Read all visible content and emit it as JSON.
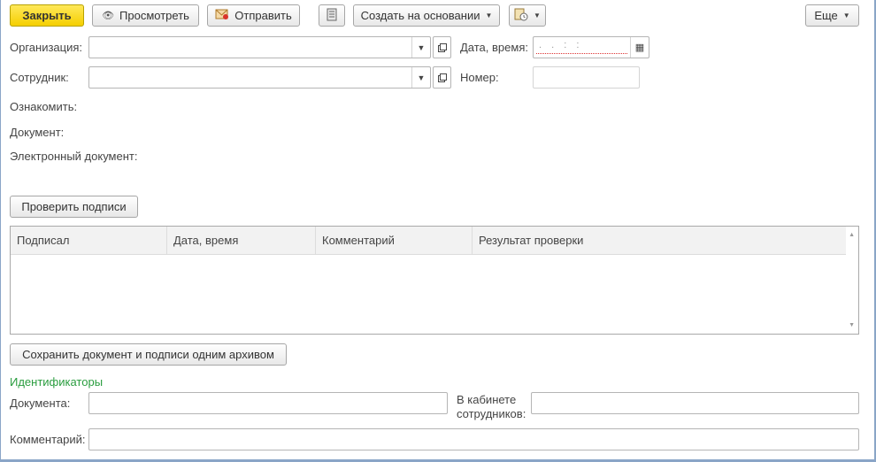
{
  "toolbar": {
    "close_label": "Закрыть",
    "view_label": "Просмотреть",
    "send_label": "Отправить",
    "create_based_label": "Создать на основании",
    "more_label": "Еще"
  },
  "fields": {
    "organization_label": "Организация:",
    "organization_value": "",
    "employee_label": "Сотрудник:",
    "employee_value": "",
    "datetime_label": "Дата, время:",
    "datetime_value": ". .   : :",
    "number_label": "Номер:",
    "number_value": "",
    "familiarize_label": "Ознакомить:",
    "document_label": "Документ:",
    "edoc_label": "Электронный документ:"
  },
  "signatures": {
    "check_button": "Проверить подписи",
    "columns": [
      "Подписал",
      "Дата, время",
      "Комментарий",
      "Результат проверки"
    ],
    "rows": [],
    "save_archive_button": "Сохранить документ и подписи одним архивом"
  },
  "identifiers": {
    "section_title": "Идентификаторы",
    "document_label": "Документа:",
    "document_value": "",
    "cabinet_label_line1": "В кабинете",
    "cabinet_label_line2": "сотрудников:",
    "cabinet_value": ""
  },
  "comment": {
    "label": "Комментарий:",
    "value": ""
  },
  "colors": {
    "primary_button": "#f5cf00",
    "section_title": "#2a9d3f",
    "frame": "#8aa5c7"
  }
}
